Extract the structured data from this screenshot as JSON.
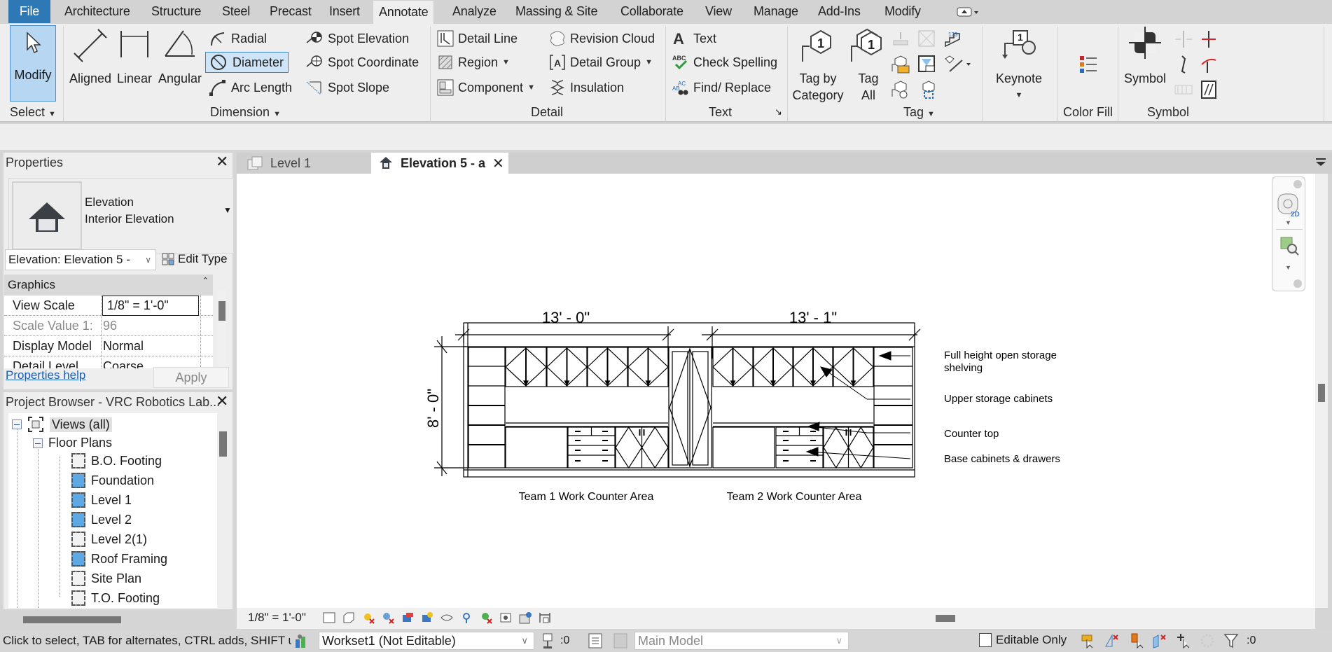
{
  "menu": {
    "tabs": [
      "File",
      "Architecture",
      "Structure",
      "Steel",
      "Precast",
      "Insert",
      "Annotate",
      "Analyze",
      "Massing & Site",
      "Collaborate",
      "View",
      "Manage",
      "Add-Ins",
      "Modify"
    ],
    "active_tab": "Annotate"
  },
  "ribbon": {
    "select": {
      "modify": "Modify",
      "panel": "Select"
    },
    "dimension": {
      "aligned": "Aligned",
      "linear": "Linear",
      "angular": "Angular",
      "radial": "Radial",
      "diameter": "Diameter",
      "arc_length": "Arc  Length",
      "spot_elevation": "Spot  Elevation",
      "spot_coordinate": "Spot  Coordinate",
      "spot_slope": "Spot  Slope",
      "panel": "Dimension"
    },
    "detail": {
      "detail_line": "Detail  Line",
      "region": "Region",
      "component": "Component",
      "revision_cloud": "Revision  Cloud",
      "detail_group": "Detail  Group",
      "insulation": "Insulation",
      "panel": "Detail"
    },
    "text": {
      "text": "Text",
      "check_spelling": "Check  Spelling",
      "find_replace": "Find/  Replace",
      "panel": "Text"
    },
    "tag": {
      "tag_by_category_1": "Tag by",
      "tag_by_category_2": "Category",
      "tag_all_1": "Tag",
      "tag_all_2": "All",
      "panel": "Tag"
    },
    "keynote": {
      "label": "Keynote"
    },
    "color_fill": {
      "panel": "Color Fill"
    },
    "symbol": {
      "label": "Symbol",
      "panel": "Symbol"
    }
  },
  "properties": {
    "title": "Properties",
    "type_line1": "Elevation",
    "type_line2": "Interior Elevation",
    "instance_selector": "Elevation: Elevation 5 -",
    "edit_type": "Edit Type",
    "group": "Graphics",
    "rows": [
      {
        "key": "View Scale",
        "value": "1/8\" = 1'-0\""
      },
      {
        "key": "Scale Value    1:",
        "value": "96"
      },
      {
        "key": "Display Model",
        "value": "Normal"
      },
      {
        "key": "Detail Level",
        "value": "Coarse"
      }
    ],
    "help_link": "Properties help",
    "apply": "Apply"
  },
  "project_browser": {
    "title": "Project Browser - VRC Robotics Lab...",
    "root": "Views (all)",
    "group": "Floor Plans",
    "items": [
      {
        "label": "B.O. Footing",
        "open": false
      },
      {
        "label": "Foundation",
        "open": true
      },
      {
        "label": "Level 1",
        "open": true
      },
      {
        "label": "Level 2",
        "open": true
      },
      {
        "label": "Level 2(1)",
        "open": false
      },
      {
        "label": "Roof Framing",
        "open": true
      },
      {
        "label": "Site Plan",
        "open": false
      },
      {
        "label": "T.O. Footing",
        "open": false
      }
    ]
  },
  "view_tabs": [
    {
      "label": "Level 1",
      "active": false
    },
    {
      "label": "Elevation 5 - a",
      "active": true
    }
  ],
  "drawing": {
    "dim_left": "13' - 0\"",
    "dim_right": "13' - 1\"",
    "dim_height": "8' - 0\"",
    "caption_left": "Team 1 Work Counter Area",
    "caption_right": "Team 2 Work Counter Area",
    "notes": [
      {
        "line1": "Full height open storage",
        "line2": "shelving"
      },
      {
        "line1": "Upper storage cabinets",
        "line2": ""
      },
      {
        "line1": "Counter top",
        "line2": ""
      },
      {
        "line1": "Base cabinets & drawers",
        "line2": ""
      }
    ]
  },
  "view_control_bar": {
    "scale": "1/8\" = 1'-0\""
  },
  "status": {
    "hint": "Click to select, TAB for alternates, CTRL adds, SHIFT u",
    "workset": "Workset1 (Not Editable)",
    "worksets_count": ":0",
    "design_option": "Main Model",
    "editable_only": "Editable Only",
    "filter_count": ":0"
  }
}
